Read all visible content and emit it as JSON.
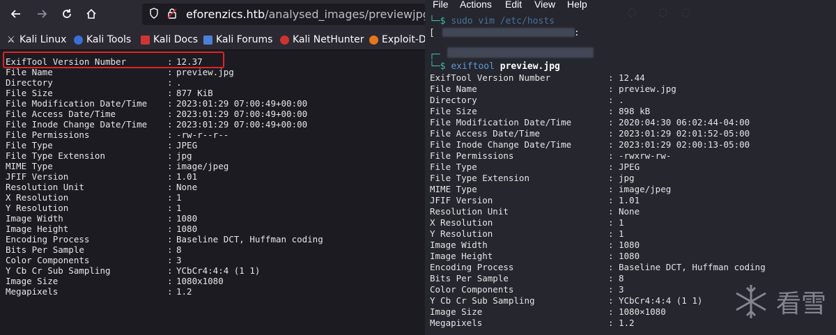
{
  "browser": {
    "url_domain": "eforenzics.htb",
    "url_path": "/analysed_images/previewjpg.txt",
    "bookmarks": [
      "Kali Linux",
      "Kali Tools",
      "Kali Docs",
      "Kali Forums",
      "Kali NetHunter",
      "Exploit-D"
    ],
    "exif": [
      [
        "ExifTool Version Number",
        "12.37"
      ],
      [
        "File Name",
        "preview.jpg"
      ],
      [
        "Directory",
        "."
      ],
      [
        "File Size",
        "877 KiB"
      ],
      [
        "File Modification Date/Time",
        "2023:01:29 07:00:49+00:00"
      ],
      [
        "File Access Date/Time",
        "2023:01:29 07:00:49+00:00"
      ],
      [
        "File Inode Change Date/Time",
        "2023:01:29 07:00:49+00:00"
      ],
      [
        "File Permissions",
        "-rw-r--r--"
      ],
      [
        "File Type",
        "JPEG"
      ],
      [
        "File Type Extension",
        "jpg"
      ],
      [
        "MIME Type",
        "image/jpeg"
      ],
      [
        "JFIF Version",
        "1.01"
      ],
      [
        "Resolution Unit",
        "None"
      ],
      [
        "X Resolution",
        "1"
      ],
      [
        "Y Resolution",
        "1"
      ],
      [
        "Image Width",
        "1080"
      ],
      [
        "Image Height",
        "1080"
      ],
      [
        "Encoding Process",
        "Baseline DCT, Huffman coding"
      ],
      [
        "Bits Per Sample",
        "8"
      ],
      [
        "Color Components",
        "3"
      ],
      [
        "Y Cb Cr Sub Sampling",
        "YCbCr4:4:4 (1 1)"
      ],
      [
        "Image Size",
        "1080x1080"
      ],
      [
        "Megapixels",
        "1.2"
      ]
    ]
  },
  "terminal": {
    "menu": [
      "File",
      "Actions",
      "Edit",
      "View",
      "Help"
    ],
    "cmd1_prefix": "└─$ ",
    "cmd1": "sudo vim /etc/hosts",
    "cmd1_bracket": "[",
    "cmd1_colon": ":",
    "cmd2_corner": "┌─",
    "cmd2_prefix": "└─$ ",
    "cmd2_program": "exiftool",
    "cmd2_arg": "preview.jpg",
    "exif": [
      [
        "ExifTool Version Number",
        "12.44"
      ],
      [
        "File Name",
        "preview.jpg"
      ],
      [
        "Directory",
        "."
      ],
      [
        "File Size",
        "898 kB"
      ],
      [
        "File Modification Date/Time",
        "2020:04:30 06:02:44-04:00"
      ],
      [
        "File Access Date/Time",
        "2023:01:29 02:01:52-05:00"
      ],
      [
        "File Inode Change Date/Time",
        "2023:01:29 02:00:13-05:00"
      ],
      [
        "File Permissions",
        "-rwxrw-rw-"
      ],
      [
        "File Type",
        "JPEG"
      ],
      [
        "File Type Extension",
        "jpg"
      ],
      [
        "MIME Type",
        "image/jpeg"
      ],
      [
        "JFIF Version",
        "1.01"
      ],
      [
        "Resolution Unit",
        "None"
      ],
      [
        "X Resolution",
        "1"
      ],
      [
        "Y Resolution",
        "1"
      ],
      [
        "Image Width",
        "1080"
      ],
      [
        "Image Height",
        "1080"
      ],
      [
        "Encoding Process",
        "Baseline DCT, Huffman coding"
      ],
      [
        "Bits Per Sample",
        "8"
      ],
      [
        "Color Components",
        "3"
      ],
      [
        "Y Cb Cr Sub Sampling",
        "YCbCr4:4:4 (1 1)"
      ],
      [
        "Image Size",
        "1080×1080"
      ],
      [
        "Megapixels",
        "1.2"
      ]
    ]
  },
  "watermark": {
    "text": "看雪"
  },
  "colors": {
    "highlight": "#e02424",
    "prompt_green": "#3fb9a6",
    "command_blue": "#5b9bd5"
  }
}
